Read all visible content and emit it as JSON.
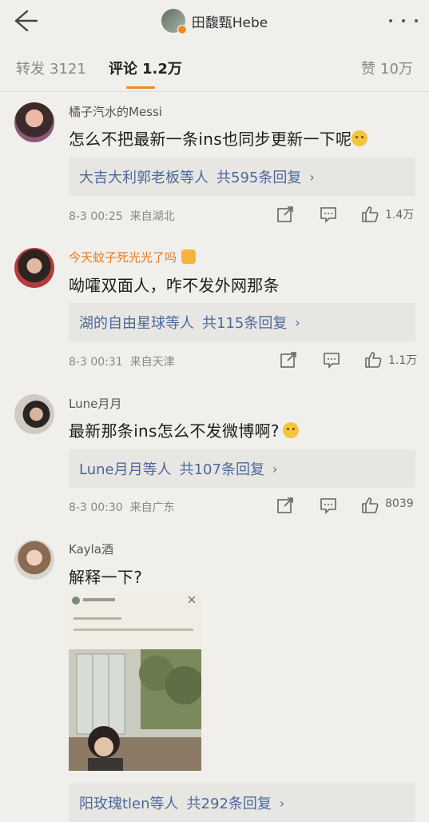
{
  "header": {
    "title": "田馥甄Hebe"
  },
  "tabs": {
    "repost_label": "转发",
    "repost_count": "3121",
    "comment_label": "评论",
    "comment_count": "1.2万",
    "like_label": "赞",
    "like_count": "10万"
  },
  "colors": {
    "accent": "#f08a1c",
    "link": "#4a6a9c",
    "background": "#f1efec"
  },
  "comments": [
    {
      "username": "橘子汽水的Messi",
      "text": "怎么不把最新一条ins也同步更新一下呢",
      "reply_who": "大吉大利郭老板等人",
      "reply_count": "共595条回复",
      "time": "8-3 00:25",
      "location": "来自湖北",
      "likes": "1.4万"
    },
    {
      "username": "今天蚊子死光光了吗",
      "text": "呦嚯双面人，咋不发外网那条",
      "reply_who": "湖的自由星球等人",
      "reply_count": "共115条回复",
      "time": "8-3 00:31",
      "location": "来自天津",
      "likes": "1.1万"
    },
    {
      "username": "Lune月月",
      "text": "最新那条ins怎么不发微博啊?",
      "reply_who": "Lune月月等人",
      "reply_count": "共107条回复",
      "time": "8-3 00:30",
      "location": "来自广东",
      "likes": "8039"
    },
    {
      "username": "Kayla酒",
      "text": "解释一下?",
      "reply_who": "阳玫瑰tlen等人",
      "reply_count": "共292条回复"
    }
  ],
  "chevron": "›",
  "icons": [
    "back-arrow-icon",
    "more-icon",
    "repost-icon",
    "comment-icon",
    "like-icon"
  ]
}
